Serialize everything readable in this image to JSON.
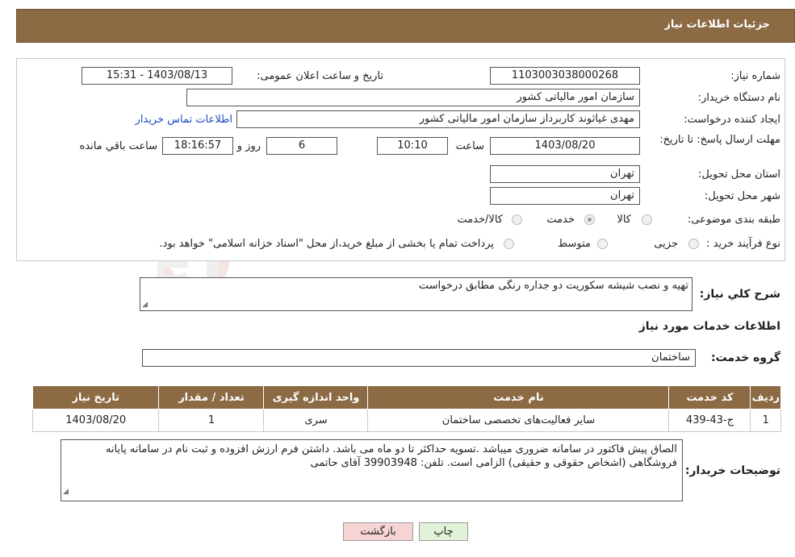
{
  "header": {
    "title": "جزئیات اطلاعات نیاز"
  },
  "form": {
    "need_number": {
      "label": "شماره نیاز:",
      "value": "1103003038000268"
    },
    "announce_datetime": {
      "label": "تاریخ و ساعت اعلان عمومی:",
      "value": "1403/08/13 - 15:31"
    },
    "buyer_org": {
      "label": "نام دستگاه خریدار:",
      "value": "سازمان امور مالیاتی کشور"
    },
    "creator": {
      "label": "ایجاد کننده درخواست:",
      "value": "مهدی غیاثوند کاربرداز سازمان امور مالیاتی کشور",
      "contact_link": "اطلاعات تماس خریدار"
    },
    "deadline": {
      "label": "مهلت ارسال پاسخ: تا تاریخ:",
      "date": "1403/08/20",
      "time_label": "ساعت",
      "time": "10:10",
      "days": "6",
      "days_label": "روز و",
      "remaining": "18:16:57",
      "remaining_label": "ساعت باقي مانده"
    },
    "province": {
      "label": "استان محل تحویل:",
      "value": "تهران"
    },
    "city": {
      "label": "شهر محل تحویل:",
      "value": "تهران"
    },
    "category": {
      "label": "طبقه بندی موضوعی:",
      "options": [
        {
          "label": "کالا",
          "selected": false
        },
        {
          "label": "خدمت",
          "selected": true
        },
        {
          "label": "کالا/خدمت",
          "selected": false
        }
      ]
    },
    "purchase_type": {
      "label": "نوع فرآیند خرید :",
      "options": [
        {
          "label": "جزیی",
          "selected": false
        },
        {
          "label": "متوسط",
          "selected": false
        }
      ],
      "note": "پرداخت تمام یا بخشی از مبلغ خرید،از محل \"اسناد خزانه اسلامی\" خواهد بود."
    }
  },
  "description": {
    "label": "شرح کلي نياز:",
    "value": "تهیه و نصب شیشه سکوریت دو جداره رنگی مطابق درخواست"
  },
  "services": {
    "section_title": "اطلاعات خدمات مورد نیاز",
    "group_label": "گروه خدمت:",
    "group_value": "ساختمان",
    "columns": [
      "ردیف",
      "کد خدمت",
      "نام خدمت",
      "واحد اندازه گیری",
      "تعداد / مقدار",
      "تاریخ نیاز"
    ],
    "rows": [
      [
        "1",
        "ج-43-439",
        "سایر فعالیت‌های تخصصی ساختمان",
        "سری",
        "1",
        "1403/08/20"
      ]
    ]
  },
  "buyer_notes": {
    "label": "توضیحات خریدار:",
    "value": "الصاق پیش فاکتور در سامانه ضروری میباشد .تسویه حداکثر تا دو ماه می باشد.  داشتن فرم ارزش افزوده و ثبت نام در سامانه پایانه فروشگاهی (اشخاص حقوقی و حقیقی) الزامی است. تلفن:  39903948 آقای حاتمی"
  },
  "buttons": {
    "print": "چاپ",
    "back": "بازگشت"
  },
  "watermark": "AriaTender.neT"
}
